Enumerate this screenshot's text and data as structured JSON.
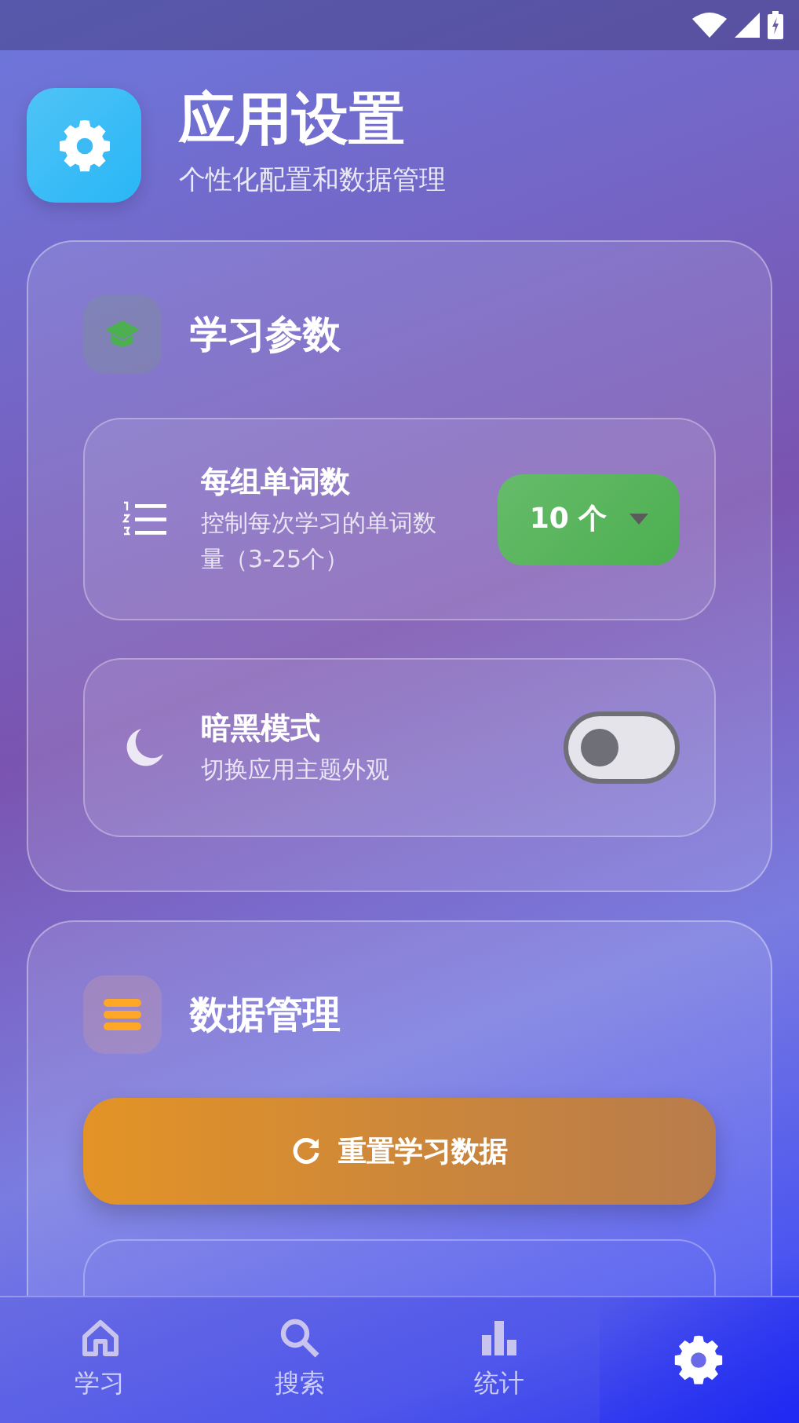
{
  "header": {
    "title": "应用设置",
    "subtitle": "个性化配置和数据管理"
  },
  "sections": [
    {
      "kind": "study",
      "title": "学习参数",
      "settings": [
        {
          "kind": "select",
          "label": "每组单词数",
          "description": "控制每次学习的单词数量（3-25个）",
          "value": "10 个"
        },
        {
          "kind": "toggle",
          "label": "暗黑模式",
          "description": "切换应用主题外观",
          "on": false
        }
      ]
    },
    {
      "kind": "data",
      "title": "数据管理",
      "settings": [
        {
          "kind": "button",
          "label": "重置学习数据"
        }
      ]
    }
  ],
  "nav": [
    {
      "kind": "home",
      "label": "学习",
      "selected": false
    },
    {
      "kind": "search",
      "label": "搜索",
      "selected": false
    },
    {
      "kind": "stats",
      "label": "统计",
      "selected": false
    },
    {
      "kind": "settings",
      "selected": true
    }
  ]
}
